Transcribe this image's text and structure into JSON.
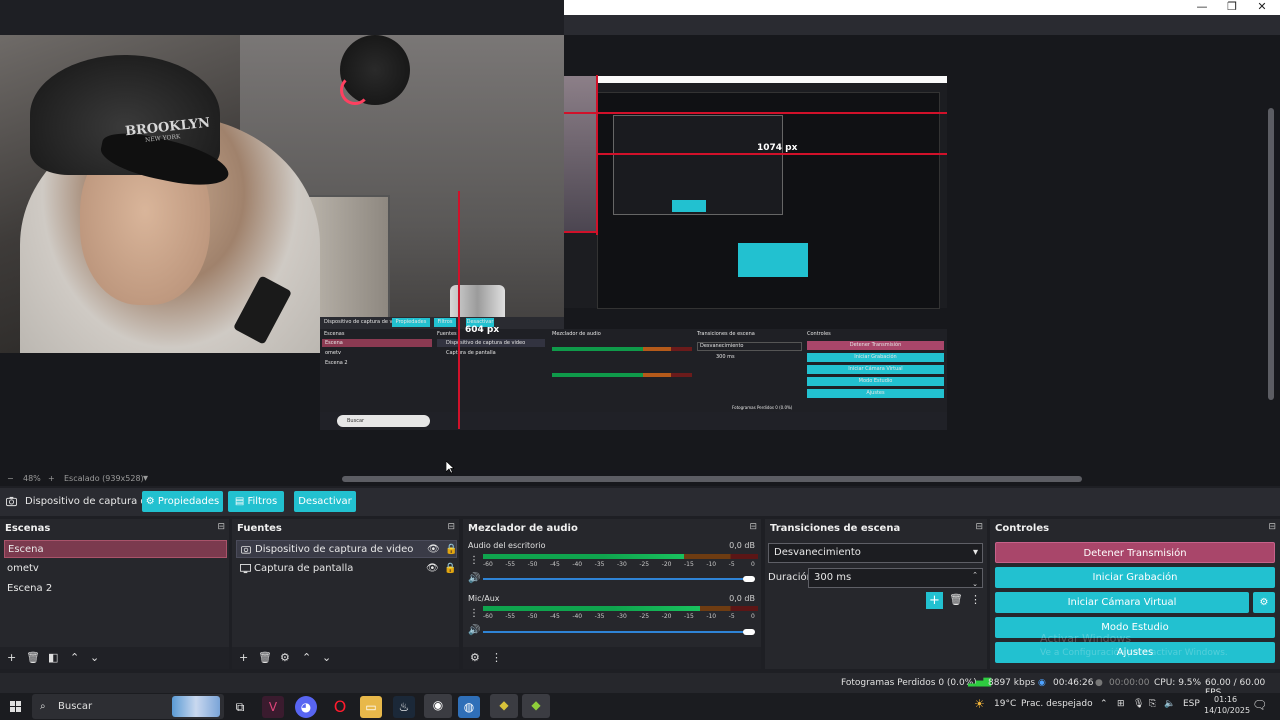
{
  "window": {
    "controls": {
      "minimize": "—",
      "maximize": "❐",
      "close": "✕"
    }
  },
  "preview": {
    "webcam": {
      "cap_text": "BROOKLYN",
      "cap_subtext": "NEW YORK"
    },
    "measure_horizontal": "1074 px",
    "measure_vertical": "604 px",
    "nested_panel": {
      "source_name": "Dispositivo de captura de v",
      "props": "Propiedades",
      "filters": "Filtros",
      "deactivate": "Desactivar",
      "scenes_title": "Escenas",
      "scene_items": [
        "Escena",
        "ometv",
        "Escena 2"
      ],
      "sources_title": "Fuentes",
      "source_items": [
        "Dispositivo de captura de video",
        "Captura de pantalla"
      ],
      "mixer_title": "Mezclador de audio",
      "transitions_title": "Transiciones de escena",
      "controls_title": "Controles",
      "transition": "Desvanecimiento",
      "duration": "300 ms",
      "ctrl_buttons": [
        "Detener Transmisión",
        "Iniciar Grabación",
        "Iniciar Cámara Virtual",
        "Modo Estudio",
        "Ajustes"
      ],
      "status": "Fotogramas Perdidos 0 (0.0%)",
      "search": "Buscar"
    }
  },
  "zoom": {
    "minus": "−",
    "value": "48%",
    "plus": "+",
    "mode": "Escalado (939x528)",
    "dropdown": "▾"
  },
  "source_toolbar": {
    "source_name": "Dispositivo de captura de v",
    "properties": "Propiedades",
    "filters": "Filtros",
    "deactivate": "Desactivar"
  },
  "scenes": {
    "title": "Escenas",
    "items": [
      "Escena",
      "ometv",
      "Escena 2"
    ],
    "selected_index": 0
  },
  "sources": {
    "title": "Fuentes",
    "items": [
      "Dispositivo de captura de video",
      "Captura de pantalla"
    ]
  },
  "mixer": {
    "title": "Mezclador de audio",
    "channels": [
      {
        "name": "Audio del escritorio",
        "db": "0,0 dB",
        "level": 0.73
      },
      {
        "name": "Mic/Aux",
        "db": "0,0 dB",
        "level": 0.79
      }
    ],
    "scale": [
      "-60",
      "-55",
      "-50",
      "-45",
      "-40",
      "-35",
      "-30",
      "-25",
      "-20",
      "-15",
      "-10",
      "-5",
      "0"
    ]
  },
  "transitions": {
    "title": "Transiciones de escena",
    "selected": "Desvanecimiento",
    "duration_label": "Duración",
    "duration_value": "300 ms"
  },
  "controls": {
    "title": "Controles",
    "stop_stream": "Detener Transmisión",
    "start_recording": "Iniciar Grabación",
    "start_virtual_cam": "Iniciar Cámara Virtual",
    "studio_mode": "Modo Estudio",
    "settings": "Ajustes"
  },
  "watermark": {
    "line1": "Activar Windows",
    "line2": "Ve a Configuración para activar Windows."
  },
  "status": {
    "dropped_frames": "Fotogramas Perdidos 0 (0.0%)",
    "bitrate": "8897 kbps",
    "stream_time": "00:46:26",
    "rec_time": "00:00:00",
    "cpu": "CPU: 9.5%",
    "fps": "60.00 / 60.00 FPS"
  },
  "taskbar": {
    "search_placeholder": "Buscar",
    "weather": "19°C",
    "weather_text": "Prac. despejado",
    "lang": "ESP",
    "time": "01:16",
    "date": "14/10/2025"
  },
  "colors": {
    "accent": "#22c1d0",
    "selected_scene": "#7b3a4e",
    "stop_stream": "#a9466a",
    "measure_line": "#d1112a"
  }
}
